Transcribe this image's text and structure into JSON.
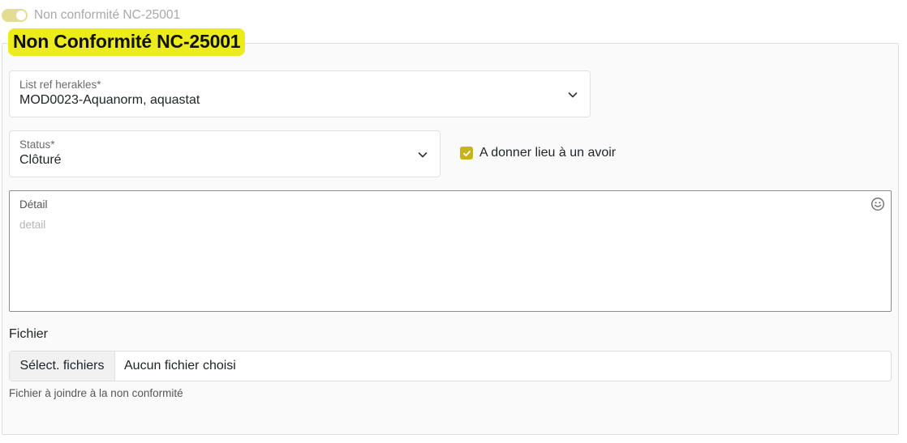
{
  "toggle": {
    "label": "Non conformité NC-25001",
    "checked": true,
    "color": "#e2dd93"
  },
  "form": {
    "legend": "Non Conformité NC-25001",
    "legend_color": "#ecec1a",
    "ref_select": {
      "label": "List ref herakles*",
      "value": "MOD0023-Aquanorm, aquastat",
      "icon": "chevron-down-icon"
    },
    "status_select": {
      "label": "Status*",
      "value": "Clôturé",
      "icon": "chevron-down-icon"
    },
    "avoir_checkbox": {
      "label": "A donner lieu à un avoir",
      "checked": true,
      "color": "#c7b41a"
    },
    "detail": {
      "label": "Détail",
      "placeholder": "detail",
      "icon": "emoji-smile-icon"
    },
    "file": {
      "heading": "Fichier",
      "button_label": "Sélect. fichiers",
      "status": "Aucun fichier choisi",
      "help": "Fichier à joindre à la non conformité"
    }
  }
}
